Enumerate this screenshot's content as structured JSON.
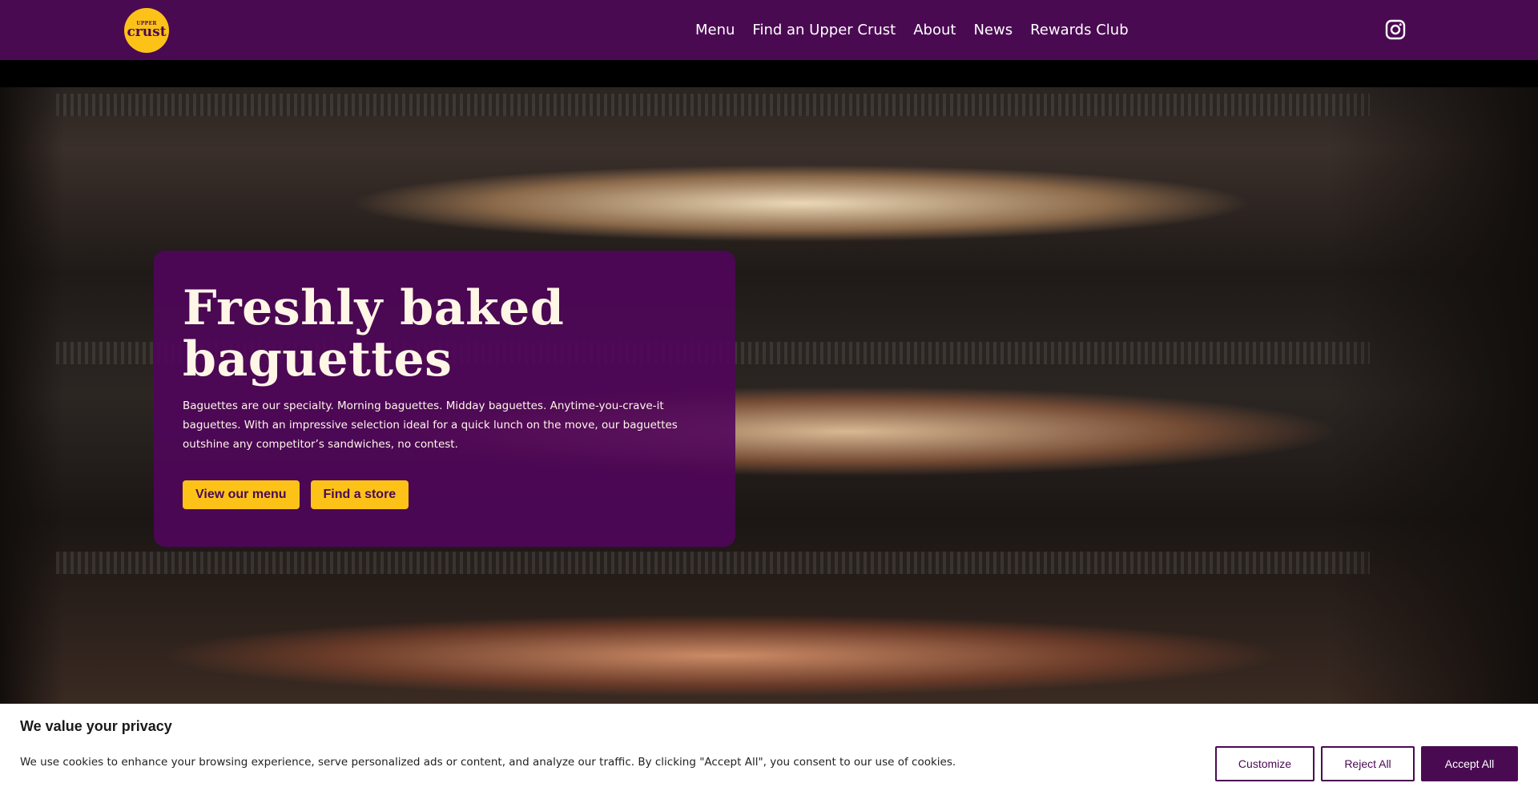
{
  "header": {
    "logo": {
      "top_text": "UPPER",
      "main_text": "crust"
    },
    "nav": [
      "Menu",
      "Find an Upper Crust",
      "About",
      "News",
      "Rewards Club"
    ],
    "social_icon": "instagram-icon"
  },
  "hero": {
    "title_line1": "Freshly baked",
    "title_line2": "baguettes",
    "description": "Baguettes are our specialty. Morning baguettes. Midday baguettes. Anytime-you-crave-it baguettes. With an impressive selection ideal for a quick lunch on the move, our baguettes outshine any competitor’s sandwiches, no contest.",
    "primary_button": "View our menu",
    "secondary_button": "Find a store"
  },
  "cookie_banner": {
    "title": "We value your privacy",
    "text": "We use cookies to enhance your browsing experience, serve personalized ads or content, and analyze our traffic. By clicking \"Accept All\", you consent to our use of cookies.",
    "customize": "Customize",
    "reject": "Reject All",
    "accept": "Accept All"
  },
  "colors": {
    "brand_purple": "#4a0a52",
    "brand_yellow": "#fcc218",
    "cream": "#fff6e6"
  }
}
